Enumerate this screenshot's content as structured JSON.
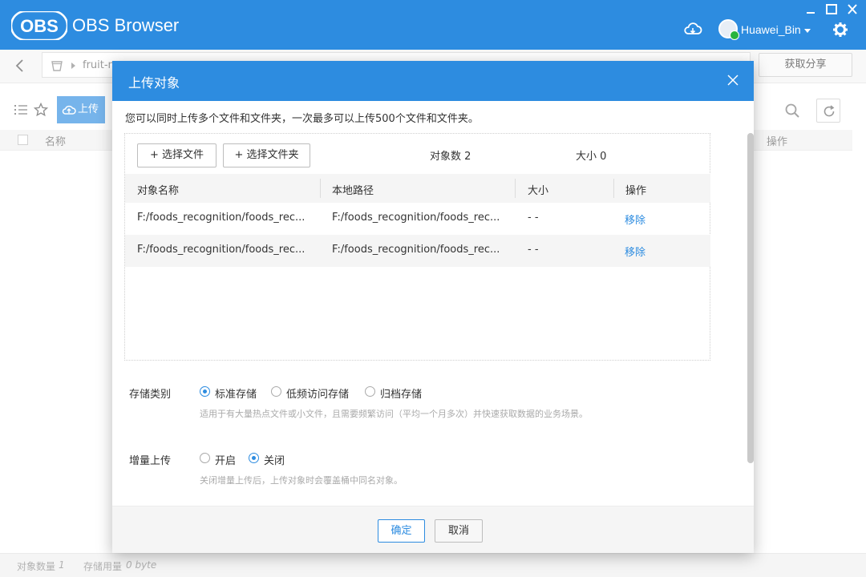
{
  "app": {
    "logo_text": "OBS",
    "title": "OBS Browser",
    "user_name": "Huawei_Bin",
    "brand_color": "#2d8ce0",
    "window_controls": [
      "minimize-icon",
      "maximize-icon",
      "close-icon"
    ]
  },
  "address_bar": {
    "path_text": "fruit-m",
    "share_button": "获取分享"
  },
  "toolbar": {
    "upload_label": "上传"
  },
  "list": {
    "col_name": "名称",
    "col_op": "操作"
  },
  "status": {
    "object_count_label": "对象数量",
    "object_count": "1",
    "storage_label": "存储用量",
    "storage_value": "0 byte"
  },
  "dialog": {
    "title": "上传对象",
    "description": "您可以同时上传多个文件和文件夹，一次最多可以上传500个文件和文件夹。",
    "select_file_btn": "+ 选择文件",
    "select_folder_btn": "+ 选择文件夹",
    "object_count_text": "对象数 2",
    "size_text": "大小 0",
    "columns": {
      "name": "对象名称",
      "local_path": "本地路径",
      "size": "大小",
      "action": "操作"
    },
    "rows": [
      {
        "name": "F:/foods_recognition/foods_rec...",
        "path": "F:/foods_recognition/foods_rec...",
        "size": "- -",
        "action": "移除"
      },
      {
        "name": "F:/foods_recognition/foods_rec...",
        "path": "F:/foods_recognition/foods_rec...",
        "size": "- -",
        "action": "移除"
      }
    ],
    "storage_class": {
      "label": "存储类别",
      "options": [
        "标准存储",
        "低频访问存储",
        "归档存储"
      ],
      "selected": "标准存储",
      "hint": "适用于有大量热点文件或小文件，且需要频繁访问（平均一个月多次）并快速获取数据的业务场景。"
    },
    "incremental": {
      "label": "增量上传",
      "options": [
        "开启",
        "关闭"
      ],
      "selected": "关闭",
      "hint": "关闭增量上传后，上传对象时会覆盖桶中同名对象。"
    },
    "ok_button": "确定",
    "cancel_button": "取消"
  }
}
